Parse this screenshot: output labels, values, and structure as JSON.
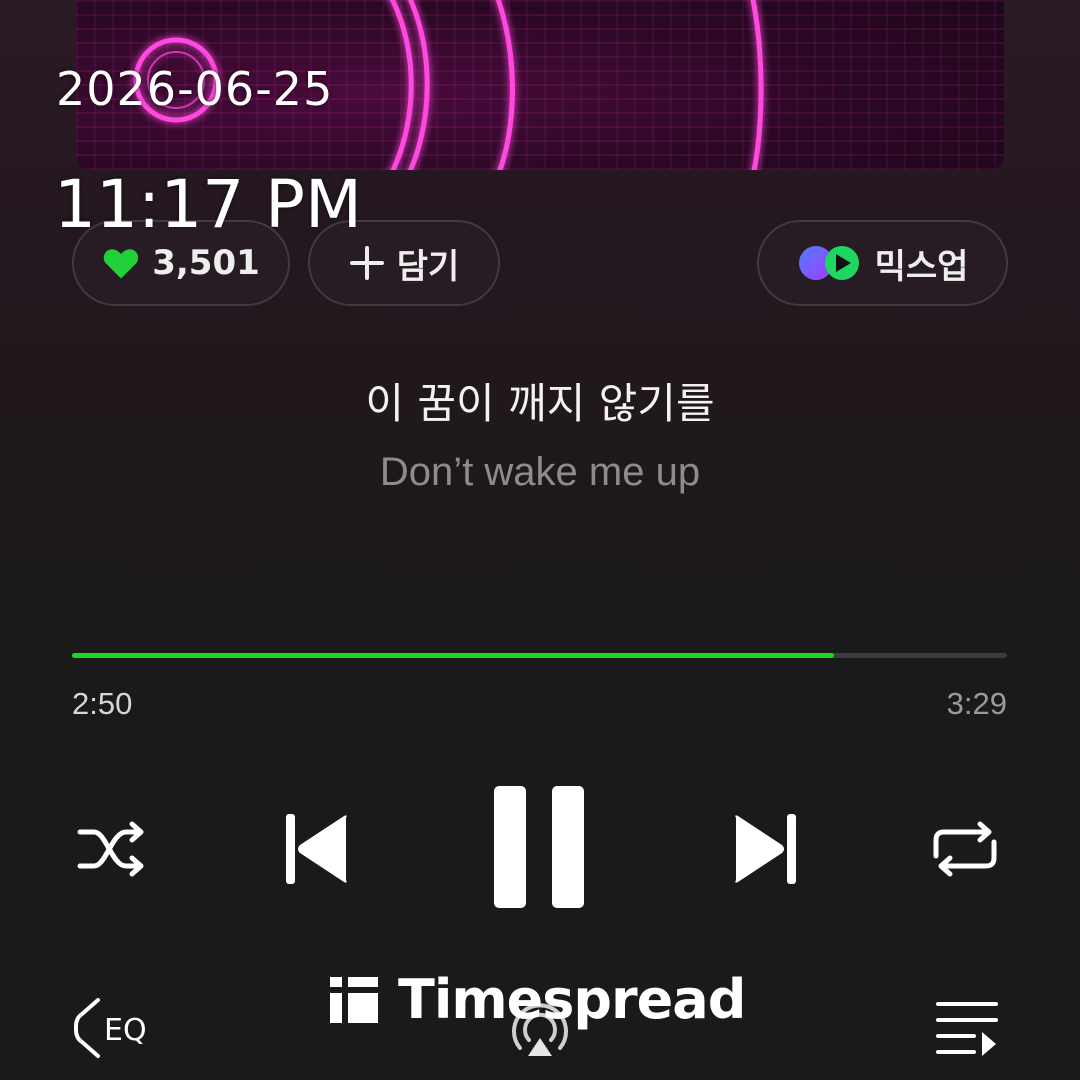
{
  "status": {
    "date": "2026-06-25",
    "time": "11:17 PM"
  },
  "actions": {
    "like_count": "3,501",
    "add_label": "담기",
    "mixup_label": "믹스업"
  },
  "lyrics": {
    "current": "이 꿈이 깨지 않기를",
    "next": "Don’t wake me up"
  },
  "playback": {
    "elapsed": "2:50",
    "duration": "3:29",
    "progress": 0.815,
    "state": "playing"
  },
  "controls": [
    "shuffle",
    "previous",
    "pause",
    "next",
    "repeat"
  ],
  "bottom_bar": {
    "eq_label": "EQ",
    "watermark": "Timespread"
  },
  "colors": {
    "accent": "#1dd71d",
    "art_neon": "#ff3cd8",
    "background": "#1a1a1a"
  },
  "icons": [
    "heart-icon",
    "plus-icon",
    "mixup-logo-icon",
    "shuffle-icon",
    "previous-icon",
    "pause-icon",
    "next-icon",
    "repeat-icon",
    "eq-icon",
    "cast-icon",
    "playlist-icon"
  ]
}
